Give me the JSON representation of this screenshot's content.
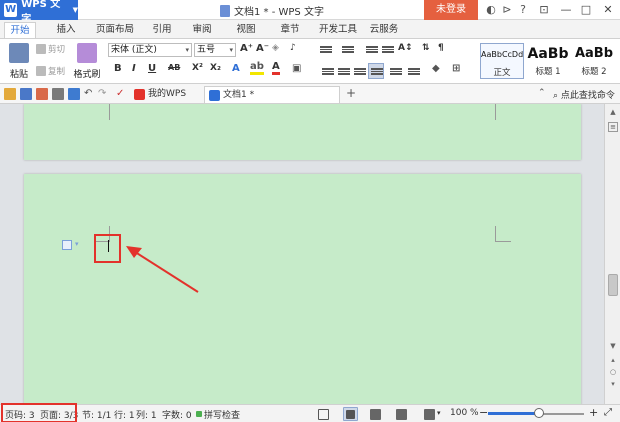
{
  "titlebar": {
    "app_name": "WPS 文字",
    "window_title": "文档1 * - WPS 文字",
    "login_button": "未登录",
    "help_label": "?"
  },
  "ribbon_tabs": [
    "开始",
    "插入",
    "页面布局",
    "引用",
    "审阅",
    "视图",
    "章节",
    "开发工具",
    "云服务"
  ],
  "ribbon": {
    "paste": "粘贴",
    "cut": "剪切",
    "copy": "复制",
    "format_painter": "格式刷",
    "font_name": "宋体 (正文)",
    "font_size": "五号",
    "bold": "B",
    "italic": "I",
    "underline": "U",
    "strike": "AB",
    "superscript": "X²",
    "subscript": "X₂",
    "grow_font": "A⁺",
    "shrink_font": "A⁻",
    "styles": [
      {
        "preview": "AaBbCcDd",
        "name": "正文"
      },
      {
        "preview": "AaBb",
        "name": "标题 1"
      },
      {
        "preview": "AaBb",
        "name": "标题 2"
      }
    ]
  },
  "qbar": {
    "doc_tab_1": "我的WPS",
    "doc_tab_2": "文档1 *",
    "add_tab": "+",
    "search_find": "点此查找命令"
  },
  "statusbar": {
    "page_num": "页码: 3",
    "pages": "页面: 3/3",
    "section": "节: 1/1",
    "row": "行: 1",
    "col": "列: 1",
    "words": "字数: 0",
    "spellcheck": "拼写检查",
    "zoom": "100 %"
  },
  "colors": {
    "brand_blue": "#2f6fd6",
    "login_orange": "#e5603f",
    "page_green": "#c6ebc9",
    "annotation_red": "#e3322b"
  },
  "zoom_level_percent": 100
}
